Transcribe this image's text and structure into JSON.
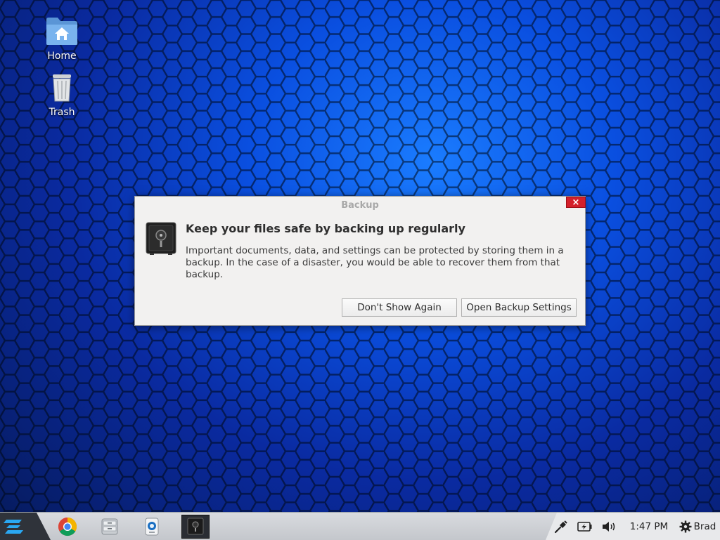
{
  "desktop": {
    "icons": [
      {
        "label": "Home"
      },
      {
        "label": "Trash"
      }
    ]
  },
  "dialog": {
    "title": "Backup",
    "close_glyph": "×",
    "heading": "Keep your files safe by backing up regularly",
    "body": "Important documents, data, and settings can be protected by storing them in a backup. In the case of a disaster, you would be able to recover them from that backup.",
    "buttons": {
      "dont_show": "Don't Show Again",
      "open_settings": "Open Backup Settings"
    },
    "icon": "safe-icon"
  },
  "taskbar": {
    "start_icon": "zorin-logo-icon",
    "launchers": [
      {
        "name": "chrome-icon"
      },
      {
        "name": "file-manager-icon"
      },
      {
        "name": "software-icon"
      },
      {
        "name": "backup-safe-icon",
        "active": true
      }
    ],
    "tray": {
      "network_icon": "network-wired-icon",
      "battery_icon": "battery-charging-icon",
      "volume_icon": "volume-icon",
      "clock": "1:47 PM",
      "user_icon": "gear-icon",
      "user_name": "Brad"
    }
  },
  "colors": {
    "close_button": "#d4202a",
    "taskbar": "#d0d2d6",
    "start_tab": "#2f333a",
    "accent": "#1a8fe0"
  }
}
